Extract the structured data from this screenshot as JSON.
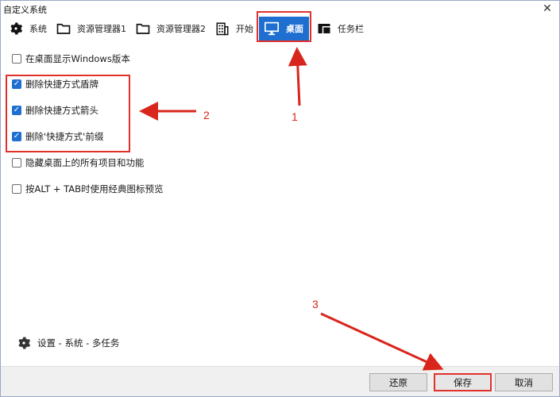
{
  "window": {
    "title": "自定义系统",
    "close_glyph": "✕"
  },
  "tabs": [
    {
      "label": "系统",
      "icon": "gear-icon",
      "active": false
    },
    {
      "label": "资源管理器1",
      "icon": "folder-icon",
      "active": false
    },
    {
      "label": "资源管理器2",
      "icon": "folder-icon",
      "active": false
    },
    {
      "label": "开始",
      "icon": "building-icon",
      "active": false
    },
    {
      "label": "桌面",
      "icon": "monitor-icon",
      "active": true
    },
    {
      "label": "任务栏",
      "icon": "taskbar-icon",
      "active": false
    }
  ],
  "options": [
    {
      "label": "在桌面显示Windows版本",
      "checked": false
    },
    {
      "label": "删除快捷方式盾牌",
      "checked": true
    },
    {
      "label": "删除快捷方式箭头",
      "checked": true
    },
    {
      "label": "删除'快捷方式'前缀",
      "checked": true
    },
    {
      "label": "隐藏桌面上的所有项目和功能",
      "checked": false
    },
    {
      "label": "按ALT + TAB时使用经典图标预览",
      "checked": false
    }
  ],
  "settings_path": "设置 - 系统 - 多任务",
  "buttons": {
    "restore": "还原",
    "save": "保存",
    "cancel": "取消"
  },
  "annotations": {
    "one": "1",
    "two": "2",
    "three": "3"
  },
  "colors": {
    "accent": "#1f6fd1",
    "annotation": "#e0322b"
  }
}
